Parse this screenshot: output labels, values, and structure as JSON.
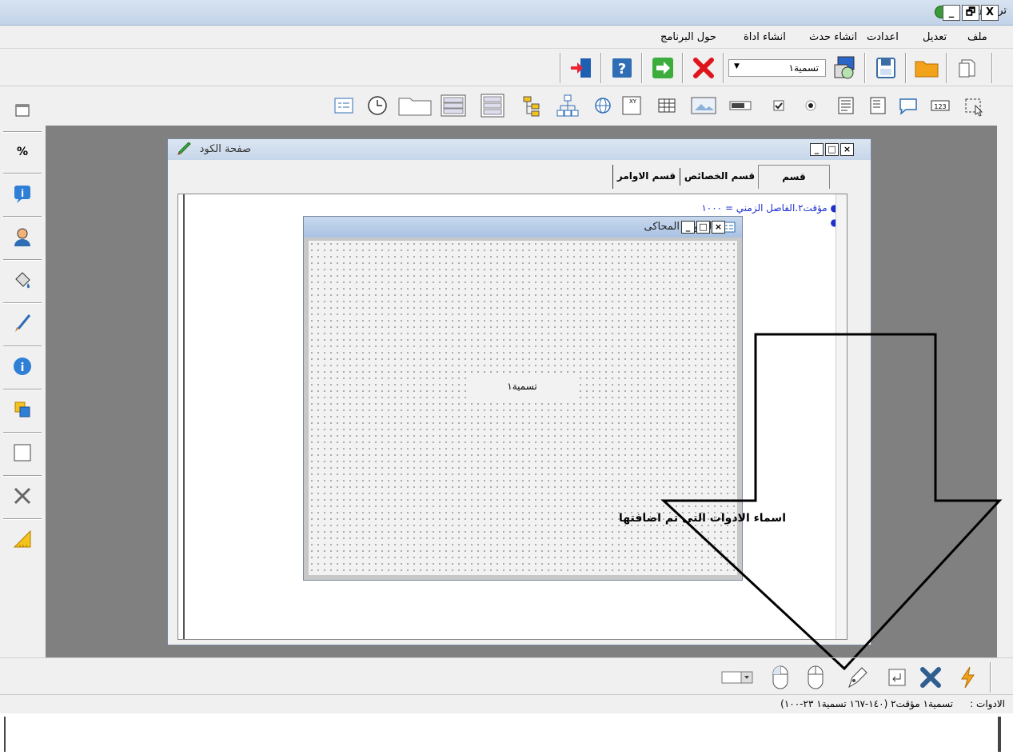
{
  "window": {
    "title": "ترجمان",
    "buttons": [
      "_",
      "🗗",
      "X"
    ]
  },
  "menu": [
    "ملف",
    "تعديل",
    "اعدادت",
    "انشاء حدث",
    "انشاء اداة",
    "حول البرنامج"
  ],
  "toolbar": {
    "object_select_value": "تسمية١"
  },
  "code_window": {
    "title": "صفحة الكود",
    "tabs": [
      "قسم التعريفات",
      "قسم الخصائص",
      "قسم الاوامر"
    ],
    "code_lines": [
      "مؤقت٢.الفاصل الزمني = ١٠٠٠",
      ""
    ]
  },
  "form_window": {
    "title": "النموذج المحاكى",
    "label_text": "تسمية١"
  },
  "annotation": {
    "text": "اسماء الادوات التى تم اضافتها"
  },
  "status": {
    "label": "الادوات :",
    "items": "تسمية١ مؤقت٢ (١٤٠-١٦٧ تسمية١ ٢٣-١٠٠)"
  },
  "icons": {
    "top_row": [
      "new-icon",
      "open-folder-icon",
      "save-icon",
      "compile-icon",
      "delete-icon",
      "run-icon",
      "help-icon",
      "exit-icon"
    ],
    "tool_row": [
      "selection-icon",
      "number-box-icon",
      "comment-icon",
      "listbox-icon",
      "text-lines-icon",
      "radio-icon",
      "checkbox-icon",
      "progress-icon",
      "image-icon",
      "table-icon",
      "xy-icon",
      "web-icon",
      "tree-icon",
      "hierarchy-icon",
      "list-view-icon",
      "multi-list-icon",
      "frame-icon",
      "clock-icon",
      "form-icon"
    ],
    "left_column": [
      "window-icon",
      "percent-icon",
      "info-bubble-icon",
      "person-icon",
      "paint-bucket-icon",
      "brush-icon",
      "info-icon",
      "layers-icon",
      "rectangle-icon",
      "tools-icon",
      "ruler-icon"
    ],
    "bottom_row": [
      "lightning-icon",
      "delete-x-icon",
      "enter-icon",
      "pen-icon",
      "mouse-icon",
      "mouse-left-icon",
      "combo-icon"
    ]
  }
}
